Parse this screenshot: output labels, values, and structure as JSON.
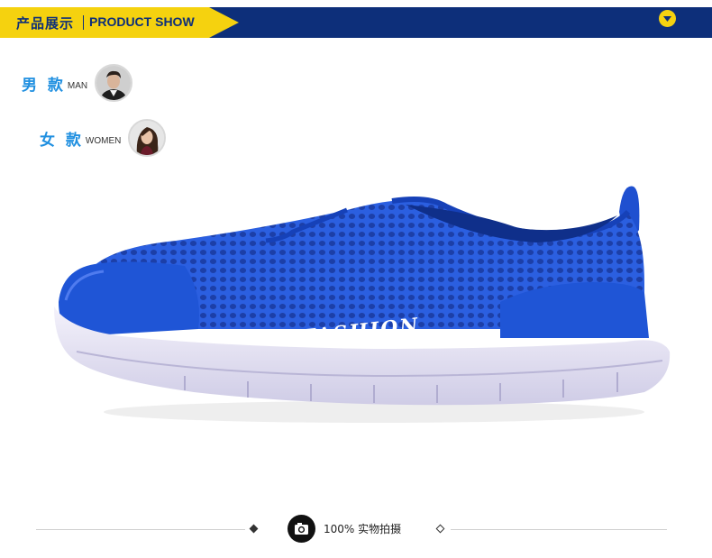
{
  "header": {
    "title_cn": "产品展示",
    "title_en": "PRODUCT SHOW",
    "dropdown_icon": "chevron-down-icon",
    "colors": {
      "banner": "#0d2f7a",
      "accent": "#f5d20f"
    }
  },
  "gender_links": [
    {
      "label_cn": "男 款",
      "label_en": "MAN",
      "icon": "avatar-man"
    },
    {
      "label_cn": "女 款",
      "label_en": "WOMEN",
      "icon": "avatar-woman"
    }
  ],
  "product": {
    "shoe_text": "FASHION",
    "color": "#1f55d6"
  },
  "footer": {
    "icon": "camera-icon",
    "caption": "100% 实物拍摄"
  }
}
